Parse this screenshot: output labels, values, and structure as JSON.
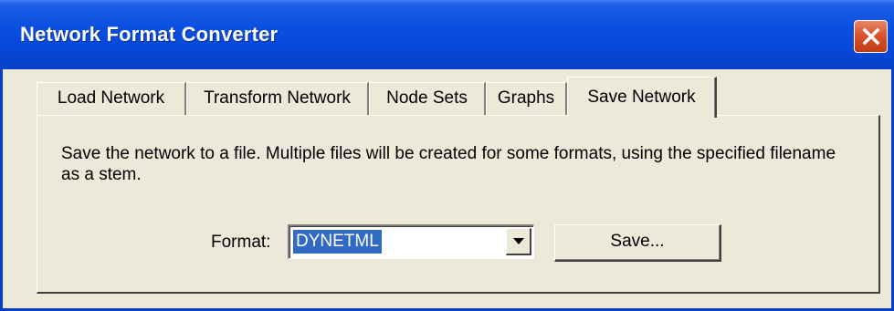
{
  "window": {
    "title": "Network Format Converter",
    "close_icon": "close-icon",
    "accent_color": "#0a4fe0"
  },
  "tabs": [
    {
      "label": "Load Network",
      "active": false
    },
    {
      "label": "Transform Network",
      "active": false
    },
    {
      "label": "Node Sets",
      "active": false
    },
    {
      "label": "Graphs",
      "active": false
    },
    {
      "label": "Save Network",
      "active": true
    }
  ],
  "save_panel": {
    "description": "Save the network to a file.  Multiple files will be created for some formats, using the specified filename as a stem.",
    "format_label": "Format:",
    "format_selected": "DYNETML",
    "dropdown_icon": "chevron-down-icon",
    "save_button_label": "Save..."
  }
}
